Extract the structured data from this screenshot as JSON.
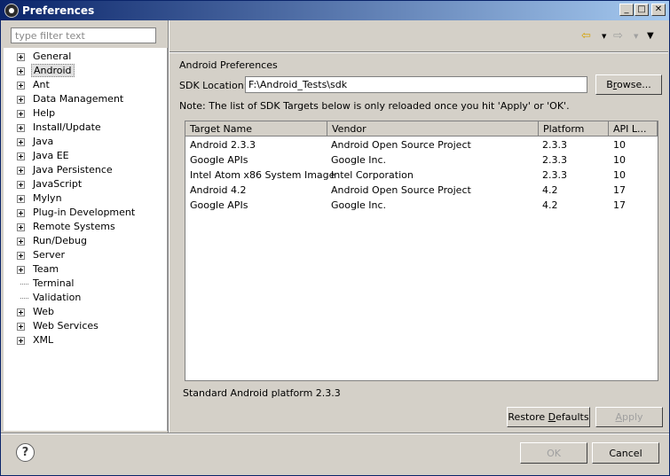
{
  "window": {
    "title": "Preferences"
  },
  "filter": {
    "placeholder": "type filter text"
  },
  "tree": [
    {
      "label": "General",
      "expandable": true
    },
    {
      "label": "Android",
      "expandable": true,
      "selected": true
    },
    {
      "label": "Ant",
      "expandable": true
    },
    {
      "label": "Data Management",
      "expandable": true
    },
    {
      "label": "Help",
      "expandable": true
    },
    {
      "label": "Install/Update",
      "expandable": true
    },
    {
      "label": "Java",
      "expandable": true
    },
    {
      "label": "Java EE",
      "expandable": true
    },
    {
      "label": "Java Persistence",
      "expandable": true
    },
    {
      "label": "JavaScript",
      "expandable": true
    },
    {
      "label": "Mylyn",
      "expandable": true
    },
    {
      "label": "Plug-in Development",
      "expandable": true
    },
    {
      "label": "Remote Systems",
      "expandable": true
    },
    {
      "label": "Run/Debug",
      "expandable": true
    },
    {
      "label": "Server",
      "expandable": true
    },
    {
      "label": "Team",
      "expandable": true
    },
    {
      "label": "Terminal",
      "expandable": false
    },
    {
      "label": "Validation",
      "expandable": false
    },
    {
      "label": "Web",
      "expandable": true
    },
    {
      "label": "Web Services",
      "expandable": true
    },
    {
      "label": "XML",
      "expandable": true
    }
  ],
  "page": {
    "title": "Android Preferences",
    "sdk_label": "SDK Location:",
    "sdk_value": "F:\\Android_Tests\\sdk",
    "browse_pre": "B",
    "browse_u": "r",
    "browse_post": "owse...",
    "note": "Note: The list of SDK Targets below is only reloaded once you hit 'Apply' or 'OK'.",
    "status": "Standard Android platform 2.3.3",
    "restore_pre": "Restore ",
    "restore_u": "D",
    "restore_post": "efaults",
    "apply_pre": "",
    "apply_u": "A",
    "apply_post": "pply"
  },
  "table": {
    "headers": [
      "Target Name",
      "Vendor",
      "Platform",
      "API L..."
    ],
    "rows": [
      [
        "Android 2.3.3",
        "Android Open Source Project",
        "2.3.3",
        "10"
      ],
      [
        "Google APIs",
        "Google Inc.",
        "2.3.3",
        "10"
      ],
      [
        "Intel Atom x86 System Image",
        "Intel Corporation",
        "2.3.3",
        "10"
      ],
      [
        "Android 4.2",
        "Android Open Source Project",
        "4.2",
        "17"
      ],
      [
        "Google APIs",
        "Google Inc.",
        "4.2",
        "17"
      ]
    ]
  },
  "footer": {
    "ok_label": "OK",
    "cancel_label": "Cancel"
  },
  "icons": {
    "help": "help-icon",
    "back": "back-arrow-icon",
    "forward": "forward-arrow-icon",
    "menu": "view-menu-icon"
  },
  "colors": {
    "titlebar_start": "#0a246a",
    "titlebar_end": "#a6caf0",
    "window_bg": "#d4d0c8"
  }
}
